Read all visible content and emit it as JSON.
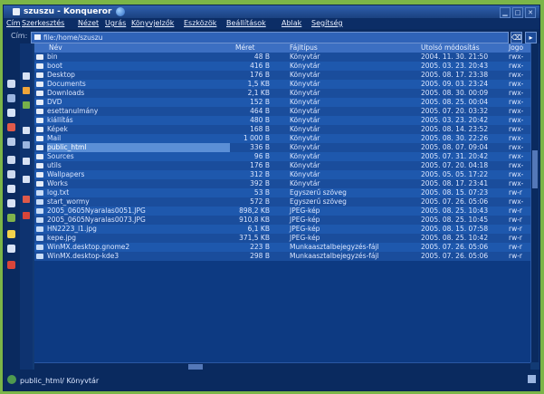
{
  "window": {
    "title": "szuszu - Konqueror"
  },
  "menu": [
    "Cím",
    "Szerkesztés",
    "Nézet",
    "Ugrás",
    "Könyvjelzők",
    "Eszközök",
    "Beállítások",
    "Ablak",
    "Segítség"
  ],
  "location": {
    "label": "Cím:",
    "url": "file:/home/szuszu"
  },
  "columns": {
    "name": "Név",
    "size": "Méret",
    "type": "Fájltípus",
    "modified": "Utolsó módosítás",
    "perm": "Jogo"
  },
  "files": [
    {
      "name": "bin",
      "size": "48 B",
      "type": "Könyvtár",
      "date": "2004. 11. 30. 21:50",
      "perm": "rwx-",
      "kind": "dir"
    },
    {
      "name": "boot",
      "size": "416 B",
      "type": "Könyvtár",
      "date": "2005. 03. 23. 20:43",
      "perm": "rwx-",
      "kind": "dir"
    },
    {
      "name": "Desktop",
      "size": "176 B",
      "type": "Könyvtár",
      "date": "2005. 08. 17. 23:38",
      "perm": "rwx-",
      "kind": "dir"
    },
    {
      "name": "Documents",
      "size": "1,5 KB",
      "type": "Könyvtár",
      "date": "2005. 09. 03. 23:24",
      "perm": "rwx-",
      "kind": "dir"
    },
    {
      "name": "Downloads",
      "size": "2,1 KB",
      "type": "Könyvtár",
      "date": "2005. 08. 30. 00:09",
      "perm": "rwx-",
      "kind": "dir"
    },
    {
      "name": "DVD",
      "size": "152 B",
      "type": "Könyvtár",
      "date": "2005. 08. 25. 00:04",
      "perm": "rwx-",
      "kind": "dir"
    },
    {
      "name": "esettanulmány",
      "size": "464 B",
      "type": "Könyvtár",
      "date": "2005. 07. 20. 03:32",
      "perm": "rwx-",
      "kind": "dir"
    },
    {
      "name": "kiállítás",
      "size": "480 B",
      "type": "Könyvtár",
      "date": "2005. 03. 23. 20:42",
      "perm": "rwx-",
      "kind": "dir"
    },
    {
      "name": "Képek",
      "size": "168 B",
      "type": "Könyvtár",
      "date": "2005. 08. 14. 23:52",
      "perm": "rwx-",
      "kind": "dir"
    },
    {
      "name": "Mail",
      "size": "1 000 B",
      "type": "Könyvtár",
      "date": "2005. 08. 30. 22:26",
      "perm": "rwx-",
      "kind": "dir"
    },
    {
      "name": "public_html",
      "size": "336 B",
      "type": "Könyvtár",
      "date": "2005. 08. 07. 09:04",
      "perm": "rwx-",
      "kind": "dir",
      "selected": true
    },
    {
      "name": "Sources",
      "size": "96 B",
      "type": "Könyvtár",
      "date": "2005. 07. 31. 20:42",
      "perm": "rwx-",
      "kind": "dir"
    },
    {
      "name": "utils",
      "size": "176 B",
      "type": "Könyvtár",
      "date": "2005. 07. 20. 04:18",
      "perm": "rwx-",
      "kind": "dir"
    },
    {
      "name": "Wallpapers",
      "size": "312 B",
      "type": "Könyvtár",
      "date": "2005. 05. 05. 17:22",
      "perm": "rwx-",
      "kind": "dir"
    },
    {
      "name": "Works",
      "size": "392 B",
      "type": "Könyvtár",
      "date": "2005. 08. 17. 23:41",
      "perm": "rwx-",
      "kind": "dir"
    },
    {
      "name": "log.txt",
      "size": "53 B",
      "type": "Egyszerű szöveg",
      "date": "2005. 08. 15. 07:23",
      "perm": "rw-r",
      "kind": "file"
    },
    {
      "name": "start_wormy",
      "size": "572 B",
      "type": "Egyszerű szöveg",
      "date": "2005. 07. 26. 05:06",
      "perm": "rwx-",
      "kind": "file"
    },
    {
      "name": "2005_0605Nyaralas0051.JPG",
      "size": "898,2 KB",
      "type": "JPEG-kép",
      "date": "2005. 08. 25. 10:43",
      "perm": "rw-r",
      "kind": "img"
    },
    {
      "name": "2005_0605Nyaralas0073.JPG",
      "size": "910,8 KB",
      "type": "JPEG-kép",
      "date": "2005. 08. 25. 10:45",
      "perm": "rw-r",
      "kind": "img"
    },
    {
      "name": "HN2223_l1.jpg",
      "size": "6,1 KB",
      "type": "JPEG-kép",
      "date": "2005. 08. 15. 07:58",
      "perm": "rw-r",
      "kind": "img"
    },
    {
      "name": "kepe.jpg",
      "size": "371,5 KB",
      "type": "JPEG-kép",
      "date": "2005. 08. 25. 10:42",
      "perm": "rw-r",
      "kind": "img"
    },
    {
      "name": "WinMX.desktop.gnome2",
      "size": "223 B",
      "type": "Munkaasztalbejegyzés-fájl",
      "date": "2005. 07. 26. 05:06",
      "perm": "rw-r",
      "kind": "doc"
    },
    {
      "name": "WinMX.desktop-kde3",
      "size": "298 B",
      "type": "Munkaasztalbejegyzés-fájl",
      "date": "2005. 07. 26. 05:06",
      "perm": "rw-r",
      "kind": "doc"
    }
  ],
  "status": {
    "text": "public_html/  Könyvtár"
  },
  "colors": {
    "accent": "#2f63b8",
    "background": "#123a74",
    "row": "#1a4d9c",
    "rowAlt": "#1e58ad",
    "selected": "#5b8fd6"
  }
}
